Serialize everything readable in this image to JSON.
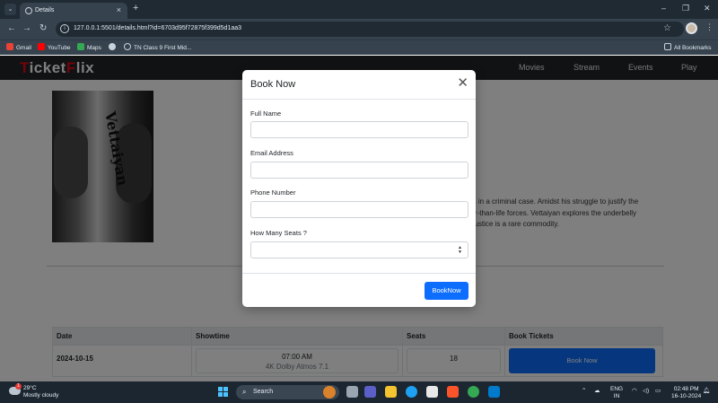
{
  "browser": {
    "tab_title": "Details",
    "url": "127.0.0.1:5501/details.html?id=6703d95f72875f399d5d1aa3",
    "bookmarks": [
      "Gmail",
      "YouTube",
      "Maps",
      "TN Class 9 First Mid..."
    ],
    "all_bookmarks": "All Bookmarks",
    "icons": {
      "back": "arrow-left-icon",
      "forward": "arrow-right-icon",
      "reload": "reload-icon",
      "star": "star-icon"
    }
  },
  "site": {
    "logo_red": "T",
    "logo_mid": "icket",
    "logo_red2": "F",
    "logo_end": "lix",
    "nav": [
      "Movies",
      "Stream",
      "Events",
      "Play"
    ]
  },
  "movie": {
    "poster_title": "Vettaiyan",
    "description_lines": [
      "nts in a criminal case. Amidst his struggle to justify the",
      "ger-than-life forces. Vettaiyan explores the underbelly",
      "e justice is a rare commodity."
    ]
  },
  "table": {
    "headers": [
      "Date",
      "Showtime",
      "Seats",
      "Book Tickets"
    ],
    "row": {
      "date": "2024-10-15",
      "time": "07:00 AM",
      "format": "4K Dolby Atmos 7.1",
      "seats": "18",
      "book": "Book Now"
    }
  },
  "modal": {
    "title": "Book Now",
    "fields": [
      {
        "label": "Full Name",
        "value": ""
      },
      {
        "label": "Email Address",
        "value": ""
      },
      {
        "label": "Phone Number",
        "value": ""
      },
      {
        "label": "How Many Seats ?",
        "value": ""
      }
    ],
    "submit": "BookNow"
  },
  "taskbar": {
    "temp": "29°C",
    "weather": "Mostly cloudy",
    "search": "Search",
    "lang1": "ENG",
    "lang2": "IN",
    "time": "02:48 PM",
    "date": "16-10-2024",
    "badge": "1"
  }
}
